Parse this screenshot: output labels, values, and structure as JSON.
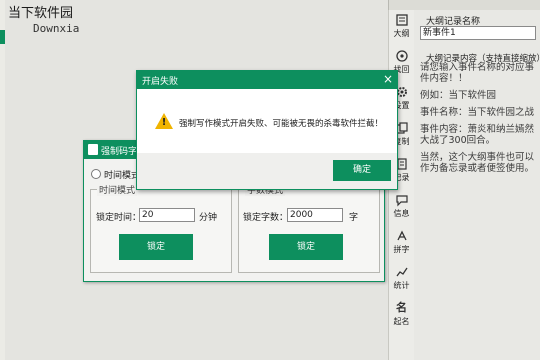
{
  "editor": {
    "title": "当下软件园",
    "body": "Downxia"
  },
  "toolbar": {
    "items": [
      {
        "label": "大纲",
        "icon": "book-icon"
      },
      {
        "label": "找回",
        "icon": "restore-icon"
      },
      {
        "label": "设置",
        "icon": "gear-icon"
      },
      {
        "label": "复制",
        "icon": "copy-icon"
      },
      {
        "label": "记录",
        "icon": "record-icon"
      },
      {
        "label": "信息",
        "icon": "info-icon"
      },
      {
        "label": "拼字",
        "icon": "spell-icon"
      },
      {
        "label": "统计",
        "icon": "chart-icon"
      },
      {
        "label": "起名",
        "icon": "name-icon"
      }
    ]
  },
  "right_panel": {
    "name_label": "大纲记录名称",
    "name_value": "新事件1",
    "content_label": "大纲记录内容（支持直接缩放）",
    "content_lines": [
      "请您输入事件名称的对应事件内容！！",
      "例如：当下软件园",
      "事件名称：当下软件园之战",
      "事件内容：萧炎和纳兰嫣然大战了300回合。",
      "当然，这个大纲事件也可以作为备忘录或者便签使用。"
    ]
  },
  "mode_dialog": {
    "title": "强制码字",
    "time_radio_label": "时间模式",
    "time_box_legend": "时间模式",
    "time_field_label": "锁定时间：",
    "time_value": "20",
    "time_unit": "分钟",
    "time_ok": "锁定",
    "count_box_legend": "字数模式",
    "count_field_label": "锁定字数：",
    "count_value": "2000",
    "count_unit": "字",
    "count_ok": "锁定"
  },
  "error_dialog": {
    "title": "开启失败",
    "close_glyph": "×",
    "message": "强制写作模式开启失败、可能被无畏的杀毒软件拦截！",
    "ok_label": "确定"
  },
  "colors": {
    "accent": "#0d8f5e",
    "warning": "#f0b400"
  }
}
